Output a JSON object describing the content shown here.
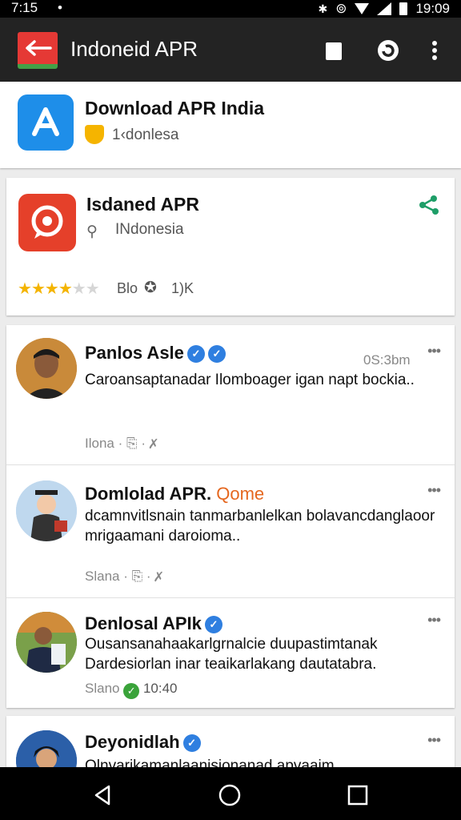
{
  "status": {
    "time": "7:15",
    "clock": "19:09"
  },
  "app_bar": {
    "title": "Indoneid APR"
  },
  "cards": {
    "download": {
      "title": "Download APR India",
      "subtitle": "1‹donlesa"
    },
    "isdaned": {
      "title": "Isdaned APR",
      "subtitle": "INdonesia",
      "meta": "Blo",
      "count": "1)K",
      "rating": 4,
      "rating_max": 6
    }
  },
  "posts": [
    {
      "name": "Panlos Asle",
      "time": "0S:3bm",
      "body": "Caroansaptanadar Ilomboager igan napt bockia..",
      "meta": "Ilona"
    },
    {
      "name": "Domlolad APR.",
      "tag": "Qome",
      "body": "dcamnvitlsnain tanmarbanlelkan bolavancdanglaoor mrigaamani daroioma..",
      "meta": "Slana"
    },
    {
      "name": "Denlosal APIk",
      "body": "Ousansanahaakarlgrnalcie duupastimtanak Dardesiorlan inar teaikarlakang dautatabra.",
      "meta": "Slano",
      "time": "10:40"
    },
    {
      "name": "Deyonidlah",
      "body": "Olnvarikamanlaanisionanad apvaaim"
    }
  ],
  "colors": {
    "accent": "#2f7fe0",
    "app_bar": "#232323",
    "orange": "#e5671f"
  }
}
